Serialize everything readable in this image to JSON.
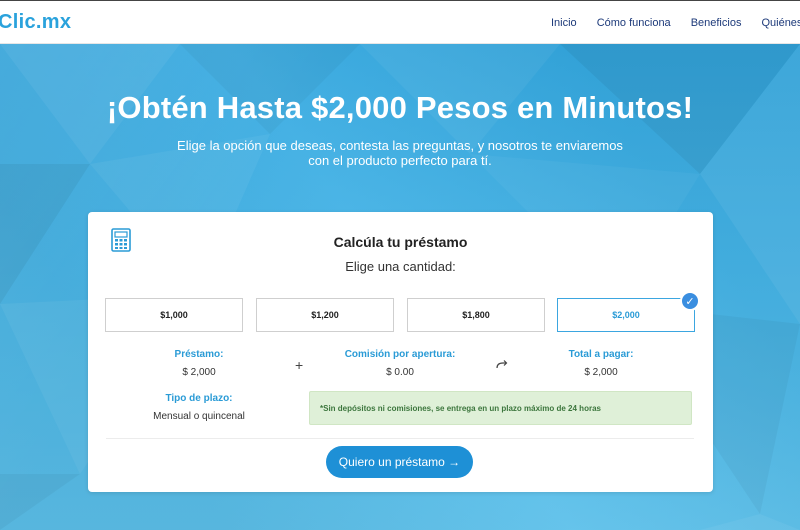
{
  "header": {
    "logo": "Clic.mx",
    "nav": [
      "Inicio",
      "Cómo funciona",
      "Beneficios",
      "Quiénes somos"
    ]
  },
  "hero": {
    "title": "¡Obtén Hasta $2,000 Pesos en Minutos!",
    "subtitle_line1": "Elige la opción que deseas, contesta las preguntas, y nosotros te enviaremos",
    "subtitle_line2": "con el producto perfecto para tí."
  },
  "calculator": {
    "title": "Calcúla tu préstamo",
    "subtitle": "Elige una cantidad:",
    "amounts": [
      "$1,000",
      "$1,200",
      "$1,800",
      "$2,000"
    ],
    "selected_amount": "$2,000",
    "loan_label": "Préstamo:",
    "loan_value": "$ 2,000",
    "fee_label": "Comisión por apertura:",
    "fee_value": "$ 0.00",
    "total_label": "Total a pagar:",
    "total_value": "$ 2,000",
    "plazo_label": "Tipo de plazo:",
    "plazo_value": "Mensual o quincenal",
    "plus_symbol": "+",
    "notice": "*Sin depósitos ni comisiones, se entrega en un plazo máximo de 24 horas",
    "cta_label": "Quiero un préstamo →"
  },
  "colors": {
    "brand": "#2aa2dc",
    "nav_text": "#1d3a7a",
    "cta": "#1e90d6",
    "notice_bg": "#dff0d8",
    "notice_text": "#3c763d"
  },
  "icons": {
    "calculator": "calculator-icon",
    "check": "check-icon",
    "arrow": "redo-arrow-icon"
  }
}
